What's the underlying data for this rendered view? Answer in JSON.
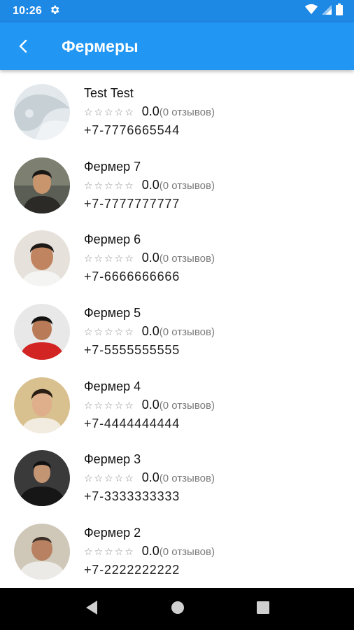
{
  "status_bar": {
    "time": "10:26"
  },
  "app_bar": {
    "title": "Фермеры"
  },
  "farmers": [
    {
      "name": "Test Test",
      "stars": "☆☆☆☆☆",
      "rating": "0.0",
      "reviews": "(0 отзывов)",
      "phone": "+7-7776665544"
    },
    {
      "name": "Фермер 7",
      "stars": "☆☆☆☆☆",
      "rating": "0.0",
      "reviews": "(0 отзывов)",
      "phone": "+7-7777777777"
    },
    {
      "name": "Фермер 6",
      "stars": "☆☆☆☆☆",
      "rating": "0.0",
      "reviews": "(0 отзывов)",
      "phone": "+7-6666666666"
    },
    {
      "name": "Фермер 5",
      "stars": "☆☆☆☆☆",
      "rating": "0.0",
      "reviews": "(0 отзывов)",
      "phone": "+7-5555555555"
    },
    {
      "name": "Фермер 4",
      "stars": "☆☆☆☆☆",
      "rating": "0.0",
      "reviews": "(0 отзывов)",
      "phone": "+7-4444444444"
    },
    {
      "name": "Фермер 3",
      "stars": "☆☆☆☆☆",
      "rating": "0.0",
      "reviews": "(0 отзывов)",
      "phone": "+7-3333333333"
    },
    {
      "name": "Фермер 2",
      "stars": "☆☆☆☆☆",
      "rating": "0.0",
      "reviews": "(0 отзывов)",
      "phone": "+7-2222222222"
    }
  ],
  "colors": {
    "app_bar": "#2196f3",
    "status_bar": "#1e88e5",
    "nav_bar": "#000000"
  }
}
